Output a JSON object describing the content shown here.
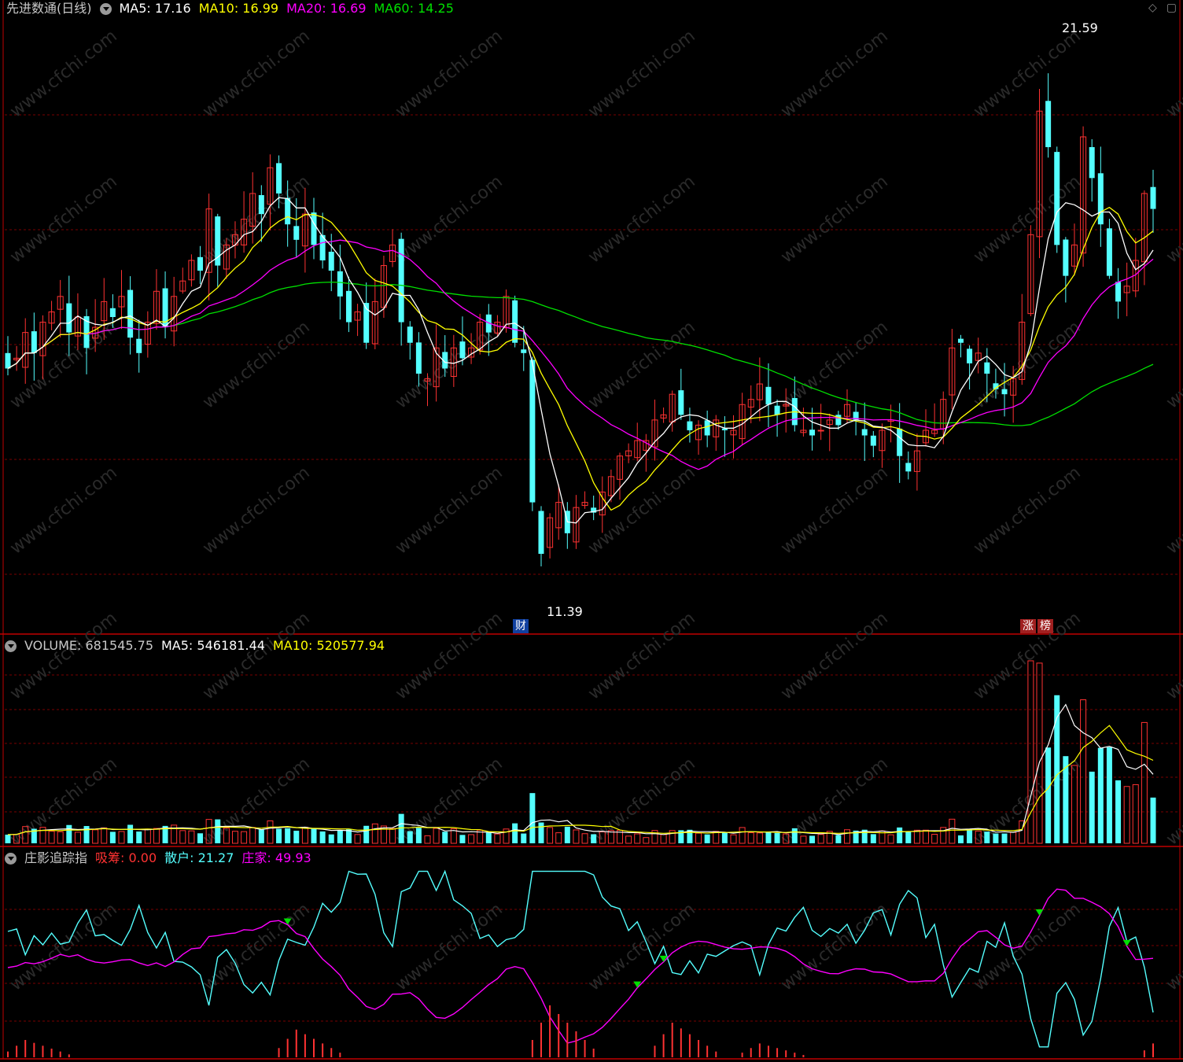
{
  "main": {
    "title": "先进数通(日线)",
    "ma5_label": "MA5: 17.16",
    "ma10_label": "MA10: 16.99",
    "ma20_label": "MA20: 16.69",
    "ma60_label": "MA60: 14.25",
    "high_label": "21.59",
    "low_label": "11.39",
    "tag_cai": "财",
    "tag_zhang": "涨",
    "tag_bang": "榜"
  },
  "volume": {
    "title": "VOLUME: 681545.75",
    "ma5_label": "MA5: 546181.44",
    "ma10_label": "MA10: 520577.94"
  },
  "indicator": {
    "title": "庄影追踪指",
    "xichou_label": "吸筹: 0.00",
    "sanhu_label": "散户: 21.27",
    "zhuangjia_label": "庄家: 49.93"
  },
  "watermark": "www.cfchi.com",
  "colors": {
    "up": "#ff3232",
    "down": "#54ffff",
    "ma5": "#ffffff",
    "ma10": "#ffff00",
    "ma20": "#ff00ff",
    "ma60": "#00e000",
    "grid": "#7a0000",
    "border": "#c00000"
  },
  "chart_data": {
    "type": "candlestick",
    "price_high": 21.59,
    "price_low": 11.39,
    "ylim": [
      10.8,
      22.2
    ],
    "candles_close": [
      15.5,
      15.7,
      16.2,
      15.8,
      16.4,
      16.6,
      16.9,
      16.2,
      16.5,
      15.9,
      16.3,
      16.8,
      16.5,
      16.9,
      16.1,
      15.8,
      16.4,
      17.0,
      16.3,
      16.9,
      17.2,
      17.6,
      17.4,
      18.6,
      17.5,
      17.9,
      18.1,
      18.4,
      18.9,
      18.5,
      19.4,
      18.9,
      18.3,
      18.0,
      18.5,
      17.9,
      17.6,
      17.4,
      16.9,
      16.4,
      16.6,
      16.0,
      16.8,
      17.5,
      17.9,
      16.4,
      16.0,
      15.4,
      15.3,
      15.9,
      15.5,
      15.9,
      15.7,
      15.9,
      16.4,
      16.2,
      16.4,
      16.9,
      16.0,
      15.8,
      12.9,
      11.9,
      12.6,
      12.9,
      12.3,
      12.8,
      12.9,
      12.7,
      13.1,
      13.4,
      13.8,
      13.9,
      14.1,
      14.1,
      14.5,
      14.6,
      15.0,
      14.6,
      14.3,
      14.4,
      14.2,
      14.5,
      14.3,
      14.3,
      14.8,
      14.9,
      15.2,
      14.8,
      14.6,
      14.8,
      14.4,
      14.3,
      14.2,
      14.3,
      14.5,
      14.4,
      14.8,
      14.5,
      14.2,
      14.0,
      14.3,
      14.5,
      13.8,
      13.5,
      13.9,
      14.3,
      14.3,
      14.9,
      15.9,
      16.0,
      15.6,
      15.8,
      15.4,
      15.1,
      15.0,
      15.3,
      16.4,
      18.1,
      20.5,
      19.8,
      17.9,
      17.3,
      17.9,
      20.0,
      19.2,
      18.3,
      17.3,
      16.8,
      17.1,
      17.6,
      18.9,
      18.6
    ],
    "ma_close": {
      "MA5": 17.16,
      "MA10": 16.99,
      "MA20": 16.69,
      "MA60": 14.25
    },
    "volume_last": 681545.75,
    "volume_ma5": 546181.44,
    "volume_ma10": 520577.94,
    "indicator_last": {
      "吸筹": 0.0,
      "散户": 21.27,
      "庄家": 49.93
    }
  }
}
